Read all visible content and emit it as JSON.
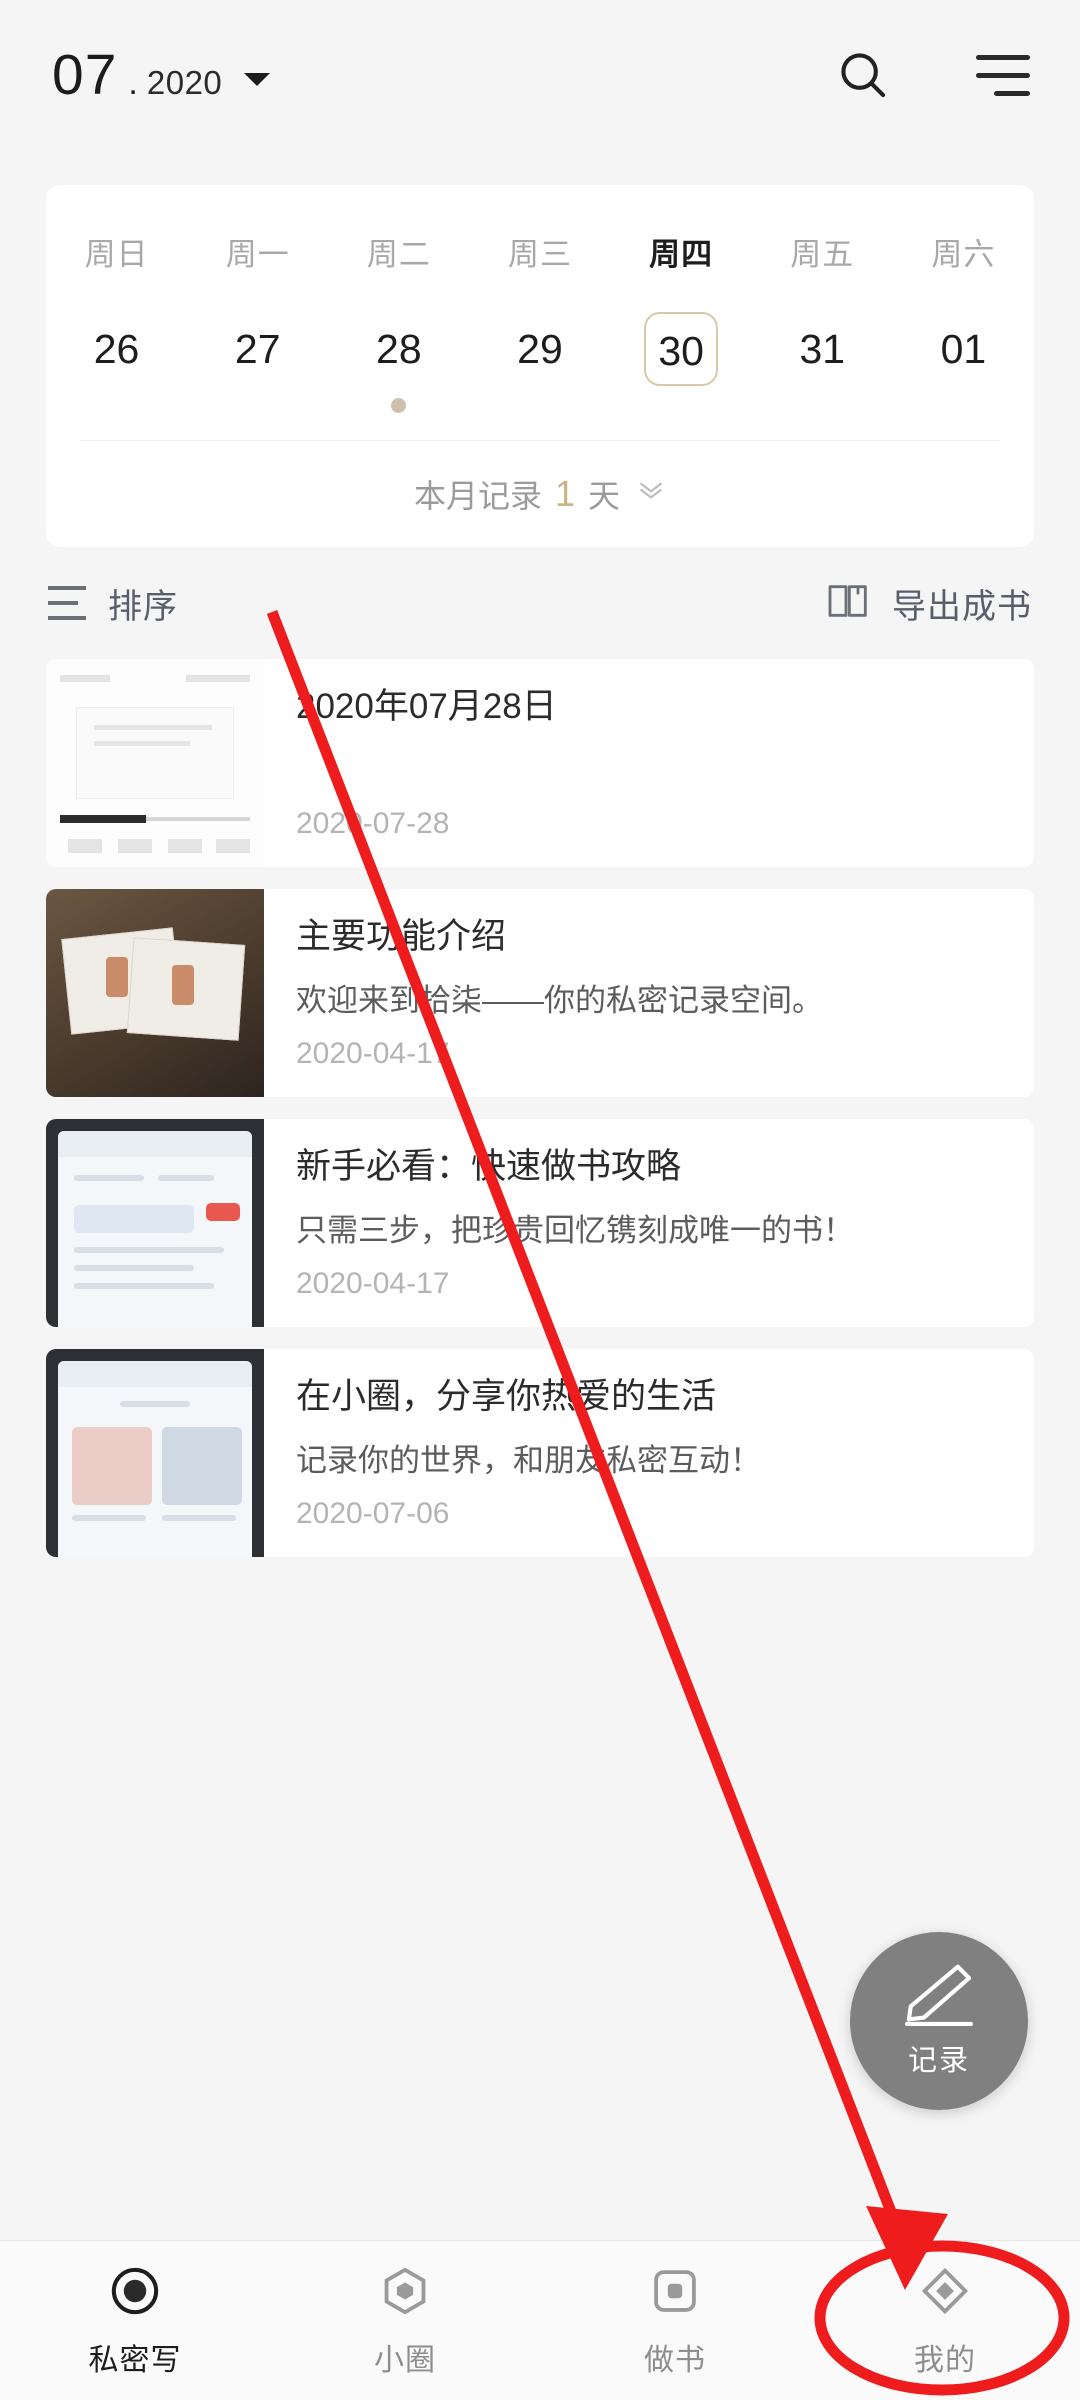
{
  "header": {
    "month": "07",
    "separator": ".",
    "year": "2020",
    "search_icon": "search-icon",
    "menu_icon": "hamburger-menu-icon"
  },
  "calendar": {
    "weekdays": [
      "周日",
      "周一",
      "周二",
      "周三",
      "周四",
      "周五",
      "周六"
    ],
    "active_weekday_index": 4,
    "days": [
      "26",
      "27",
      "28",
      "29",
      "30",
      "31",
      "01"
    ],
    "selected_index": 4,
    "event_dot_index": 2,
    "summary_prefix": "本月记录",
    "summary_count": "1",
    "summary_suffix": "天",
    "expand_icon": "chevron-double-down-icon",
    "selection_color": "#d8c9a8",
    "count_color": "#cbb487",
    "dot_color": "#cfc0ae"
  },
  "toolbar": {
    "sort_label": "排序",
    "sort_icon": "sort-lines-icon",
    "export_label": "导出成书",
    "export_icon": "open-book-icon"
  },
  "entries": [
    {
      "title": "2020年07月28日",
      "subtitle": "",
      "date": "2020-07-28",
      "thumb": "document-page"
    },
    {
      "title": "主要功能介绍",
      "subtitle": "欢迎来到拾柒——你的私密记录空间。",
      "date": "2020-04-17",
      "thumb": "photo-books"
    },
    {
      "title": "新手必看：快速做书攻略",
      "subtitle": "只需三步，把珍贵回忆镌刻成唯一的书！",
      "date": "2020-04-17",
      "thumb": "app-editor"
    },
    {
      "title": "在小圈，分享你热爱的生活",
      "subtitle": "记录你的世界，和朋友私密互动！",
      "date": "2020-07-06",
      "thumb": "app-circle"
    }
  ],
  "fab": {
    "label": "记录",
    "icon": "pencil-icon",
    "background": "#808080"
  },
  "tabbar": {
    "items": [
      {
        "label": "私密写",
        "icon": "circle-dot-icon",
        "active": true
      },
      {
        "label": "小圈",
        "icon": "hexagon-icon",
        "active": false
      },
      {
        "label": "做书",
        "icon": "rounded-square-icon",
        "active": false
      },
      {
        "label": "我的",
        "icon": "diamond-icon",
        "active": false
      }
    ]
  },
  "annotation": {
    "arrow_color": "#ee1c1c",
    "target_tab_label": "我的"
  }
}
